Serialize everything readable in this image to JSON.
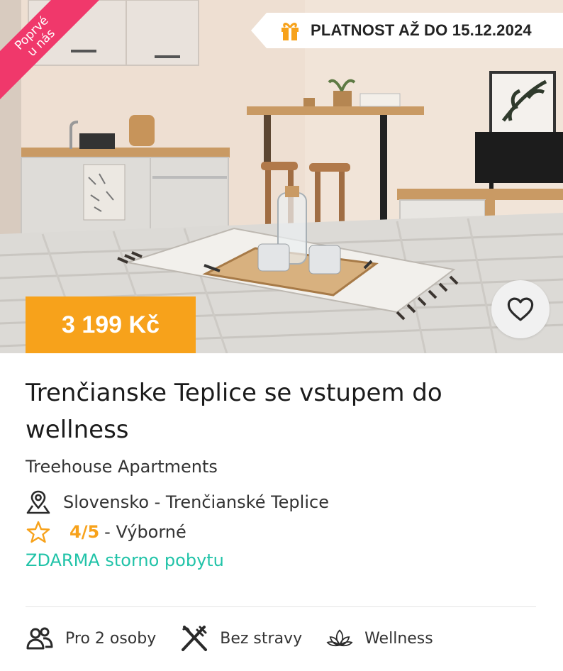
{
  "hero": {
    "ribbon_line1": "Poprvé",
    "ribbon_line2": "u nás",
    "validity": "PLATNOST AŽ DO 15.12.2024",
    "price": "3 199 Kč"
  },
  "offer": {
    "title": "Trenčianske Teplice se vstupem do wellness",
    "hotel": "Treehouse Apartments",
    "location": "Slovensko - Trenčianské Teplice",
    "rating_score": "4/5",
    "rating_label": "- Výborné",
    "free_cancellation": "ZDARMA storno pobytu"
  },
  "features": {
    "guests": "Pro 2 osoby",
    "board": "Bez stravy",
    "wellness": "Wellness"
  },
  "icons": {
    "gift": "gift-icon",
    "heart": "heart-icon",
    "location": "location-pin-icon",
    "star": "star-icon",
    "people": "people-icon",
    "cutlery": "cutlery-icon",
    "lotus": "lotus-icon"
  },
  "colors": {
    "ribbon": "#f0386b",
    "price_bg": "#f7a21b",
    "rating": "#f7a21b",
    "free_cancel": "#21c3a8"
  }
}
